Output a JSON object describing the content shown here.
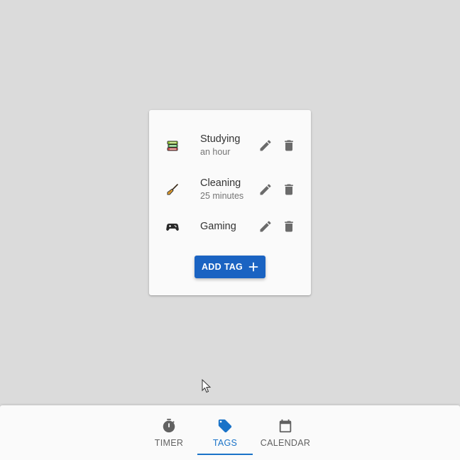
{
  "tags": [
    {
      "name": "Studying",
      "duration": "an hour",
      "emoji": "books-icon"
    },
    {
      "name": "Cleaning",
      "duration": "25 minutes",
      "emoji": "broom-icon"
    },
    {
      "name": "Gaming",
      "duration": "",
      "emoji": "game-controller-icon"
    }
  ],
  "actions": {
    "add_tag_label": "ADD TAG",
    "edit_icon": "pencil-icon",
    "delete_icon": "trash-icon"
  },
  "nav": {
    "tabs": [
      {
        "label": "TIMER",
        "icon": "stopwatch-icon",
        "active": false
      },
      {
        "label": "TAGS",
        "icon": "tag-icon",
        "active": true
      },
      {
        "label": "CALENDAR",
        "icon": "calendar-icon",
        "active": false
      }
    ]
  },
  "colors": {
    "background": "#dbdbdb",
    "primary": "#1a63c2",
    "active_tab": "#1a73c8",
    "icon_gray": "#6b6b6b"
  }
}
